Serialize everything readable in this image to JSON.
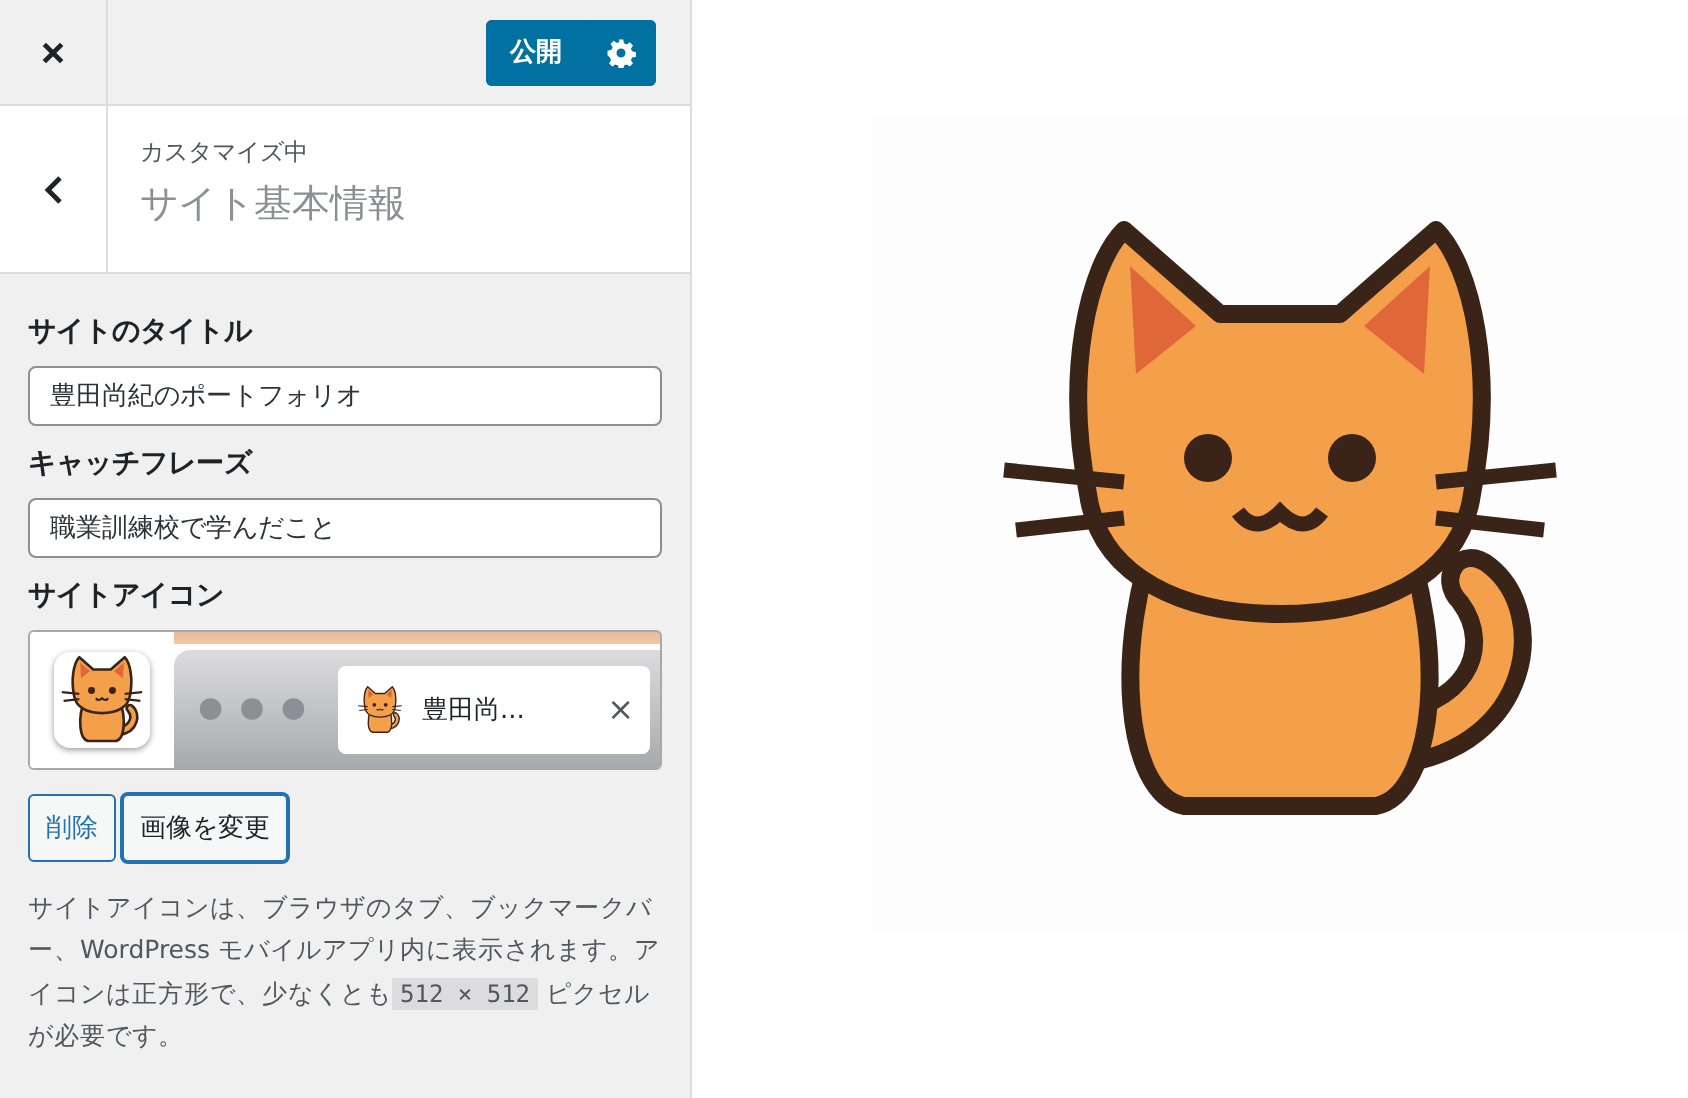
{
  "header": {
    "publish_button": "公開"
  },
  "section": {
    "breadcrumb": "カスタマイズ中",
    "title": "サイト基本情報"
  },
  "fields": [
    {
      "label": "サイトのタイトル",
      "value": "豊田尚紀のポートフォリオ"
    },
    {
      "label": "キャッチフレーズ",
      "value": "職業訓練校で学んだこと"
    }
  ],
  "site_icon": {
    "label": "サイトアイコン",
    "tab_title": "豊田尚...",
    "tab_close": "×",
    "buttons": [
      {
        "label": "削除",
        "focused": false
      },
      {
        "label": "画像を変更",
        "focused": true
      }
    ],
    "description": "サイトアイコンは、ブラウザのタブ、ブックマークバー、WordPress モバイルアプリ内に表示されます。アイコンは正方形で、少なくとも",
    "size_code": "512 × 512",
    "description_end": "ピクセルが必要です。"
  }
}
